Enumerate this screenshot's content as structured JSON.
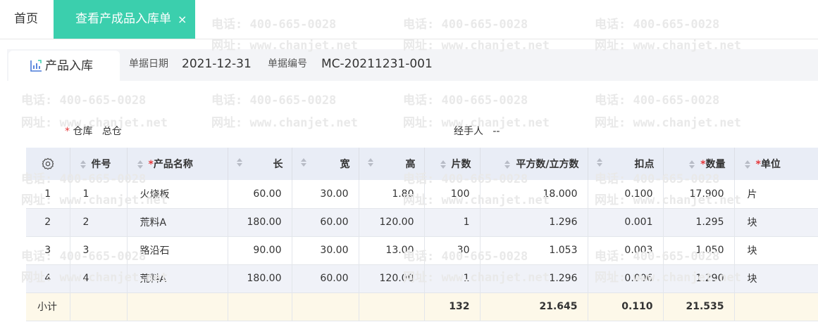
{
  "tabs": {
    "home": "首页",
    "active": "查看产成品入库单",
    "close": "×"
  },
  "doc": {
    "tab_label": "产品入库",
    "date_label": "单据日期",
    "date_value": "2021-12-31",
    "no_label": "单据编号",
    "no_value": "MC-20211231-001"
  },
  "fields": {
    "required_mark": "*",
    "warehouse_label": "仓库",
    "warehouse_value": "总仓",
    "handler_label": "经手人",
    "handler_value": "--"
  },
  "watermark": {
    "phone": "电话: 400-665-0028",
    "site": "网址: www.chanjet.net"
  },
  "table": {
    "columns": [
      "件号",
      "产品名称",
      "长",
      "宽",
      "高",
      "片数",
      "平方数/立方数",
      "扣点",
      "数量",
      "单位"
    ],
    "rows": [
      {
        "idx": "1",
        "no": "1",
        "name": "火烧板",
        "len": "60.00",
        "wid": "30.00",
        "hgt": "1.80",
        "pcs": "100",
        "area": "18.000",
        "ded": "0.100",
        "qty": "17.900",
        "unit": "片"
      },
      {
        "idx": "2",
        "no": "2",
        "name": "荒料A",
        "len": "180.00",
        "wid": "60.00",
        "hgt": "120.00",
        "pcs": "1",
        "area": "1.296",
        "ded": "0.001",
        "qty": "1.295",
        "unit": "块"
      },
      {
        "idx": "3",
        "no": "3",
        "name": "路沿石",
        "len": "90.00",
        "wid": "30.00",
        "hgt": "13.00",
        "pcs": "30",
        "area": "1.053",
        "ded": "0.003",
        "qty": "1.050",
        "unit": "块"
      },
      {
        "idx": "4",
        "no": "4",
        "name": "荒料A",
        "len": "180.00",
        "wid": "60.00",
        "hgt": "120.00",
        "pcs": "1",
        "area": "1.296",
        "ded": "0.006",
        "qty": "1.290",
        "unit": "块"
      }
    ],
    "subtotal": {
      "label": "小计",
      "pcs": "132",
      "area": "21.645",
      "ded": "0.110",
      "qty": "21.535"
    }
  }
}
